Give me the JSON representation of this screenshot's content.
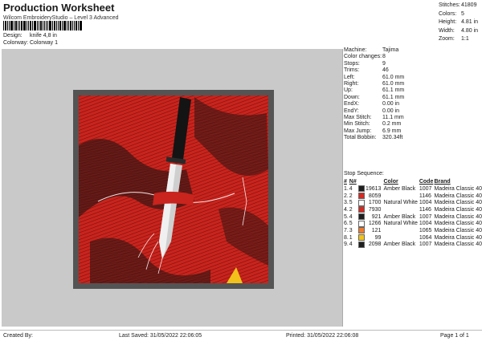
{
  "header": {
    "title": "Production Worksheet",
    "subtitle": "Wilcom EmbroideryStudio – Level 3 Advanced",
    "design_label": "Design:",
    "design_value": "knife 4,8 in",
    "colorway_label": "Colorway:",
    "colorway_value": "Colorway 1"
  },
  "summary": [
    {
      "label": "Stitches:",
      "value": "41809"
    },
    {
      "label": "Colors:",
      "value": "5"
    },
    {
      "label": "Height:",
      "value": "4.81 in"
    },
    {
      "label": "Width:",
      "value": "4.80 in"
    },
    {
      "label": "Zoom:",
      "value": "1:1"
    }
  ],
  "machine_info": [
    {
      "label": "Machine:",
      "value": "Tajima"
    },
    {
      "label": "Color changes:",
      "value": "8"
    },
    {
      "label": "Stops:",
      "value": "9"
    },
    {
      "label": "Trims:",
      "value": "46"
    },
    {
      "label": "Left:",
      "value": "61.0 mm"
    },
    {
      "label": "Right:",
      "value": "61.0 mm"
    },
    {
      "label": "Up:",
      "value": "61.1 mm"
    },
    {
      "label": "Down:",
      "value": "61.1 mm"
    },
    {
      "label": "EndX:",
      "value": "0.00 in"
    },
    {
      "label": "EndY:",
      "value": "0.00 in"
    },
    {
      "label": "Max Stitch:",
      "value": "11.1 mm"
    },
    {
      "label": "Min Stitch:",
      "value": "0.2 mm"
    },
    {
      "label": "Max Jump:",
      "value": "6.9 mm"
    },
    {
      "label": "Total Bobbin:",
      "value": "320.34ft"
    }
  ],
  "stop_sequence": {
    "heading": "Stop Sequence:",
    "columns": [
      "#",
      "N#",
      "",
      "",
      "Color",
      "Code",
      "Brand"
    ],
    "rows": [
      {
        "idx": "1.",
        "n": "4",
        "color": "#1f1f1f",
        "stitches": "19613",
        "name": "Amber Black",
        "code": "1007",
        "brand": "Madeira Classic 40"
      },
      {
        "idx": "2.",
        "n": "2",
        "color": "#d42a22",
        "stitches": "8059",
        "name": "",
        "code": "1146",
        "brand": "Madeira Classic 40"
      },
      {
        "idx": "3.",
        "n": "5",
        "color": "#ffffff",
        "stitches": "1700",
        "name": "Natural White",
        "code": "1004",
        "brand": "Madeira Classic 40"
      },
      {
        "idx": "4.",
        "n": "2",
        "color": "#d42a22",
        "stitches": "7930",
        "name": "",
        "code": "1146",
        "brand": "Madeira Classic 40"
      },
      {
        "idx": "5.",
        "n": "4",
        "color": "#1f1f1f",
        "stitches": "921",
        "name": "Amber Black",
        "code": "1007",
        "brand": "Madeira Classic 40"
      },
      {
        "idx": "6.",
        "n": "5",
        "color": "#ffffff",
        "stitches": "1266",
        "name": "Natural White",
        "code": "1004",
        "brand": "Madeira Classic 40"
      },
      {
        "idx": "7.",
        "n": "3",
        "color": "#ee7a2c",
        "stitches": "121",
        "name": "",
        "code": "1065",
        "brand": "Madeira Classic 40"
      },
      {
        "idx": "8.",
        "n": "1",
        "color": "#f2c21a",
        "stitches": "99",
        "name": "",
        "code": "1064",
        "brand": "Madeira Classic 40"
      },
      {
        "idx": "9.",
        "n": "4",
        "color": "#1f1f1f",
        "stitches": "2098",
        "name": "Amber Black",
        "code": "1007",
        "brand": "Madeira Classic 40"
      }
    ]
  },
  "footer": {
    "created_by": "Created By:",
    "last_saved": "Last Saved: 31/05/2022 22:06:05",
    "printed": "Printed: 31/05/2022 22:06:08",
    "page": "Page 1 of 1"
  }
}
